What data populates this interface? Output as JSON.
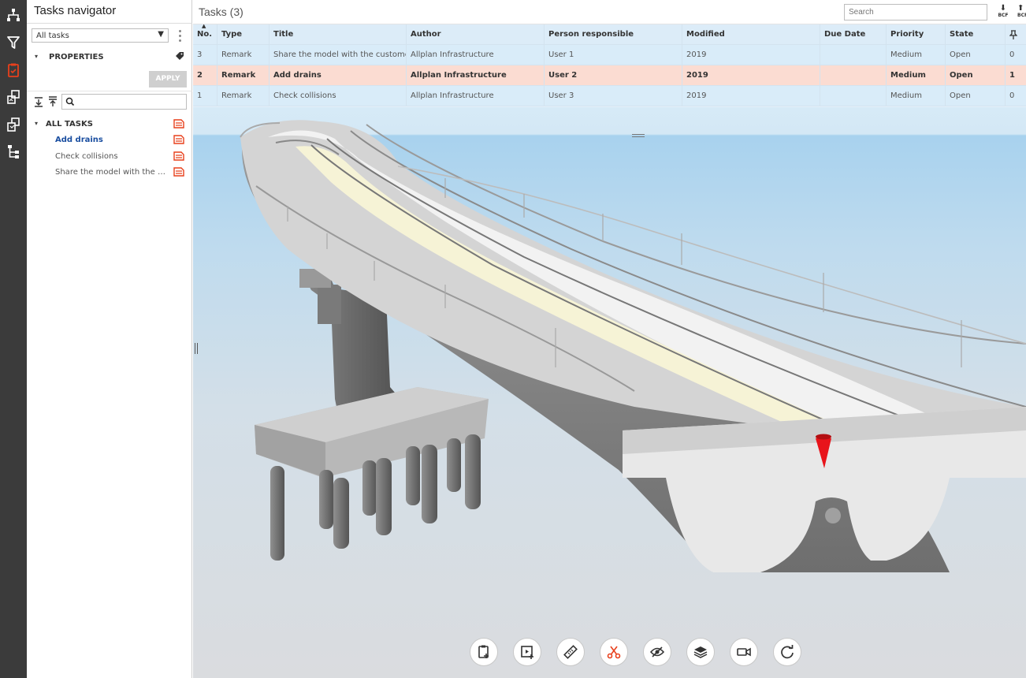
{
  "navigator": {
    "title": "Tasks navigator",
    "filter_value": "All tasks",
    "properties_label": "PROPERTIES",
    "apply_label": "APPLY",
    "search_value": "",
    "all_tasks_label": "ALL TASKS",
    "tree_items": [
      {
        "label": "Add drains",
        "active": true
      },
      {
        "label": "Check collisions",
        "active": false
      },
      {
        "label": "Share the model with the customer",
        "active": false
      }
    ]
  },
  "tasks": {
    "title": "Tasks (3)",
    "search_placeholder": "Search",
    "bcf_label": "BCF",
    "columns": [
      "No.",
      "Type",
      "Title",
      "Author",
      "Person responsible",
      "Modified",
      "Due Date",
      "Priority",
      "State"
    ],
    "rows": [
      {
        "no": "3",
        "type": "Remark",
        "title": "Share the model with the customer",
        "author": "Allplan Infrastructure",
        "person": "User 1",
        "modified": "2019",
        "due": "",
        "priority": "Medium",
        "state": "Open",
        "count": "0"
      },
      {
        "no": "2",
        "type": "Remark",
        "title": "Add drains",
        "author": "Allplan Infrastructure",
        "person": "User 2",
        "modified": "2019",
        "due": "",
        "priority": "Medium",
        "state": "Open",
        "count": "1"
      },
      {
        "no": "1",
        "type": "Remark",
        "title": "Check collisions",
        "author": "Allplan Infrastructure",
        "person": "User 3",
        "modified": "2019",
        "due": "",
        "priority": "Medium",
        "state": "Open",
        "count": "0"
      }
    ]
  },
  "colors": {
    "accent": "#e8401c",
    "rail": "#3b3b3b",
    "selected_row": "#fbdcd2",
    "table_bg": "#e6f2fb",
    "link": "#1a4ea0"
  },
  "icons": {
    "rail": [
      "model-tree-icon",
      "filter-icon",
      "tasks-clipboard-icon",
      "compare-icon",
      "copy-icon",
      "structure-icon"
    ],
    "bottom_toolbar": [
      "new-task-icon",
      "new-viewpoint-icon",
      "measure-icon",
      "section-cut-icon",
      "hide-icon",
      "layers-icon",
      "camera-icon",
      "reset-view-icon"
    ]
  }
}
